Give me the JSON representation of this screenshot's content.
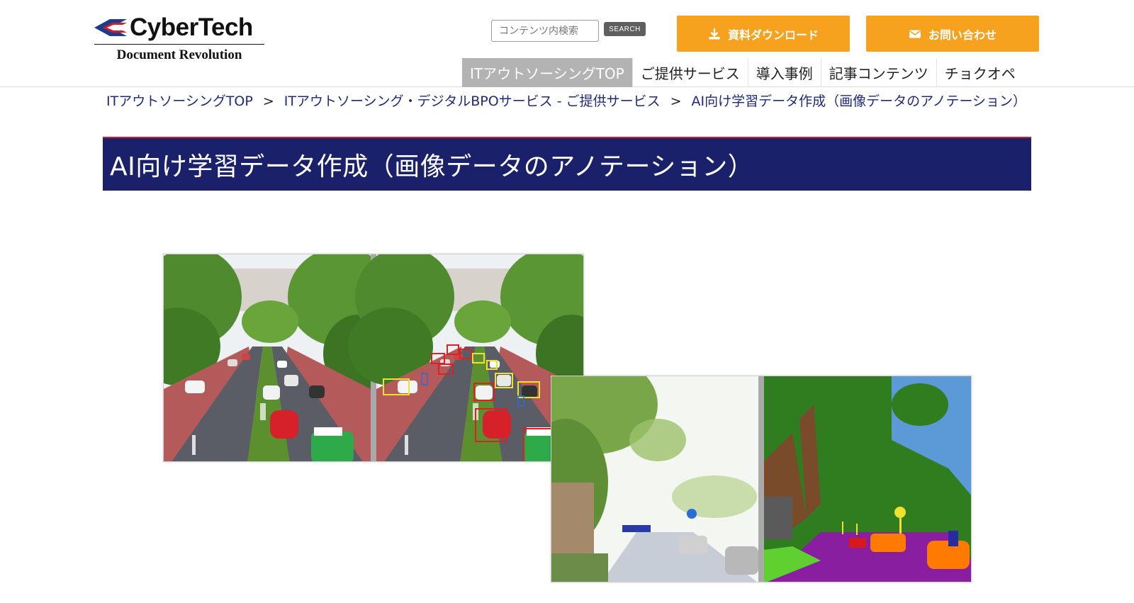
{
  "header": {
    "logo": {
      "name": "CyberTech",
      "tagline": "Document Revolution"
    },
    "search": {
      "placeholder": "コンテンツ内検索",
      "button_label": "SEARCH"
    },
    "cta": {
      "download_label": "資料ダウンロード",
      "contact_label": "お問い合わせ"
    },
    "colors": {
      "accent": "#f6a21e",
      "navy": "#1b206b",
      "red": "#d11e2a"
    }
  },
  "nav": {
    "items": [
      {
        "label": "ITアウトソーシングTOP",
        "active": true
      },
      {
        "label": "ご提供サービス"
      },
      {
        "label": "導入事例"
      },
      {
        "label": "記事コンテンツ"
      },
      {
        "label": "チョクオペ"
      }
    ]
  },
  "breadcrumb": {
    "items": [
      "ITアウトソーシングTOP",
      "ITアウトソーシング・デジタルBPOサービス - ご提供サービス",
      "AI向け学習データ作成（画像データのアノテーション）"
    ],
    "separator": ">"
  },
  "page": {
    "title": "AI向け学習データ作成（画像データのアノテーション）"
  }
}
